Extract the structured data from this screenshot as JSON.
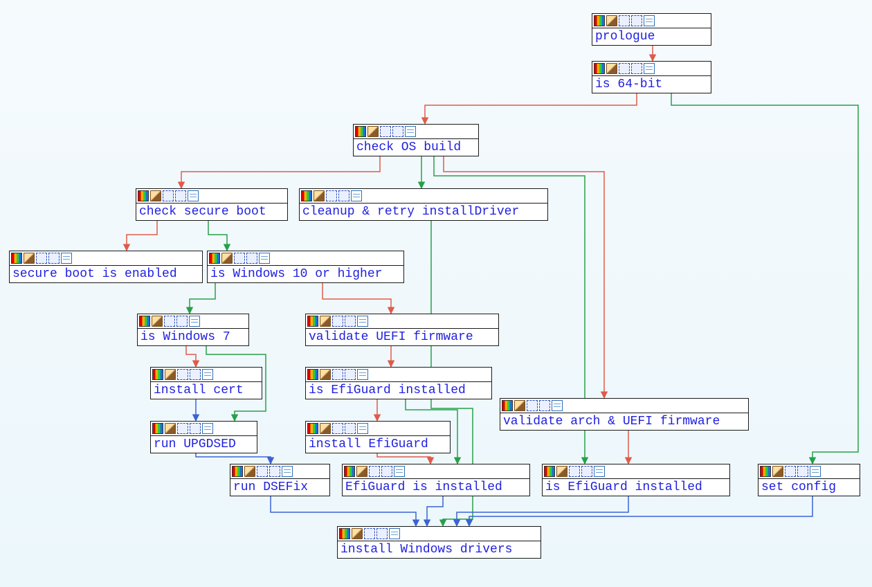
{
  "colors": {
    "edge_red": "#e05a4a",
    "edge_green": "#27a049",
    "edge_blue": "#3b63d6",
    "node_label": "#2020e0"
  },
  "icons": {
    "rainbow": "rainbow-icon",
    "pencil": "pencil-icon",
    "squiggle1": "blue-squiggle-icon",
    "squiggle2": "blue-squiggle-icon",
    "doc": "document-icon"
  },
  "nodes": {
    "prologue": {
      "label": "prologue"
    },
    "is_64bit": {
      "label": "is 64-bit"
    },
    "check_os_build": {
      "label": "check OS build"
    },
    "check_secure_boot": {
      "label": "check secure boot"
    },
    "cleanup_retry": {
      "label": "cleanup & retry installDriver"
    },
    "secure_boot_enabled": {
      "label": "secure boot is enabled"
    },
    "is_win10": {
      "label": "is Windows 10 or higher"
    },
    "is_win7": {
      "label": "is Windows 7"
    },
    "validate_uefi": {
      "label": "validate UEFI firmware"
    },
    "install_cert": {
      "label": "install cert"
    },
    "is_efiguard_installed_a": {
      "label": "is EfiGuard installed"
    },
    "run_upgdsed": {
      "label": "run UPGDSED"
    },
    "install_efiguard": {
      "label": "install EfiGuard"
    },
    "validate_arch_uefi": {
      "label": "validate arch & UEFI firmware"
    },
    "run_dsefix": {
      "label": "run DSEFix"
    },
    "efiguard_installed": {
      "label": "EfiGuard is installed"
    },
    "is_efiguard_installed_b": {
      "label": "is EfiGuard installed"
    },
    "set_config": {
      "label": "set config"
    },
    "install_drivers": {
      "label": "install Windows drivers"
    }
  },
  "edges": [
    {
      "from": "prologue",
      "to": "is_64bit",
      "type": "red"
    },
    {
      "from": "is_64bit",
      "to": "check_os_build",
      "type": "red"
    },
    {
      "from": "is_64bit",
      "to": "set_config",
      "type": "green"
    },
    {
      "from": "check_os_build",
      "to": "check_secure_boot",
      "type": "red"
    },
    {
      "from": "check_os_build",
      "to": "cleanup_retry",
      "type": "green"
    },
    {
      "from": "check_os_build",
      "to": "validate_arch_uefi",
      "type": "red"
    },
    {
      "from": "check_os_build",
      "to": "is_efiguard_installed_b",
      "type": "green"
    },
    {
      "from": "check_secure_boot",
      "to": "secure_boot_enabled",
      "type": "red"
    },
    {
      "from": "check_secure_boot",
      "to": "is_win10",
      "type": "green"
    },
    {
      "from": "is_win10",
      "to": "is_win7",
      "type": "green"
    },
    {
      "from": "is_win10",
      "to": "validate_uefi",
      "type": "red"
    },
    {
      "from": "is_win7",
      "to": "install_cert",
      "type": "red"
    },
    {
      "from": "is_win7",
      "to": "run_upgdsed",
      "type": "green"
    },
    {
      "from": "install_cert",
      "to": "run_upgdsed",
      "type": "blue"
    },
    {
      "from": "validate_uefi",
      "to": "is_efiguard_installed_a",
      "type": "red"
    },
    {
      "from": "is_efiguard_installed_a",
      "to": "install_efiguard",
      "type": "red"
    },
    {
      "from": "is_efiguard_installed_a",
      "to": "efiguard_installed",
      "type": "green"
    },
    {
      "from": "run_upgdsed",
      "to": "run_dsefix",
      "type": "blue"
    },
    {
      "from": "install_efiguard",
      "to": "efiguard_installed",
      "type": "red"
    },
    {
      "from": "cleanup_retry",
      "to": "install_drivers",
      "type": "green"
    },
    {
      "from": "validate_arch_uefi",
      "to": "is_efiguard_installed_b",
      "type": "red"
    },
    {
      "from": "run_dsefix",
      "to": "install_drivers",
      "type": "blue"
    },
    {
      "from": "efiguard_installed",
      "to": "install_drivers",
      "type": "blue"
    },
    {
      "from": "is_efiguard_installed_b",
      "to": "install_drivers",
      "type": "blue"
    },
    {
      "from": "set_config",
      "to": "install_drivers",
      "type": "blue"
    }
  ]
}
